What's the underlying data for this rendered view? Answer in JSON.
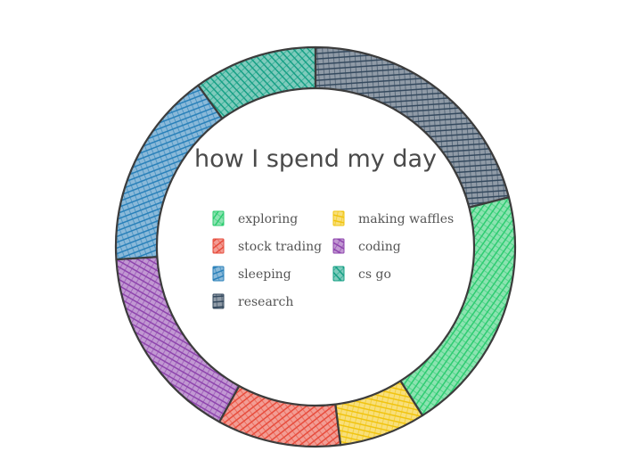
{
  "chart_data": {
    "type": "doughnut",
    "title": "how I spend my day",
    "labels": [
      "exploring",
      "stock trading",
      "sleeping",
      "research",
      "making waffles",
      "coding",
      "cs go"
    ],
    "colors": [
      "#2ecc71",
      "#e74c3c",
      "#2980b9",
      "#34495e",
      "#f1c40f",
      "#8e44ad",
      "#16a085"
    ],
    "slice_order": [
      "research",
      "exploring",
      "making waffles",
      "stock trading",
      "coding",
      "sleeping",
      "cs go"
    ],
    "values": {
      "research": 21,
      "exploring": 20,
      "making waffles": 7,
      "stock trading": 10,
      "coding": 16,
      "sleeping": 16,
      "cs go": 10
    },
    "legend_placement": "center"
  }
}
